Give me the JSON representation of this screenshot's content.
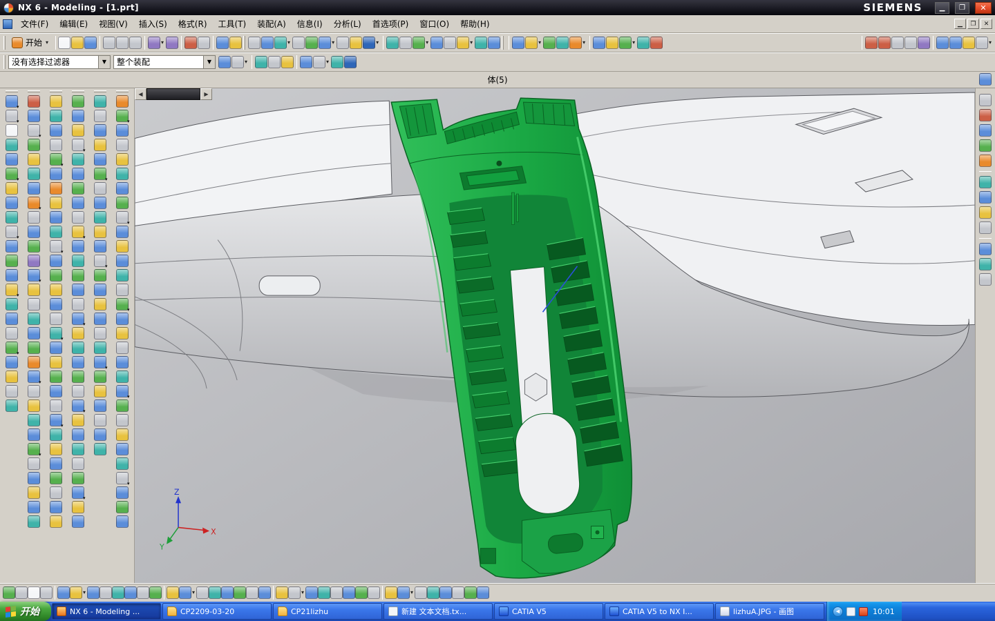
{
  "window": {
    "title": "NX 6 - Modeling - [1.prt]",
    "brand": "SIEMENS"
  },
  "menubar": {
    "items": [
      "文件(F)",
      "编辑(E)",
      "视图(V)",
      "插入(S)",
      "格式(R)",
      "工具(T)",
      "装配(A)",
      "信息(I)",
      "分析(L)",
      "首选项(P)",
      "窗口(O)",
      "帮助(H)"
    ]
  },
  "toolbars": {
    "start_button": "开始",
    "filter_value": "没有选择过滤器",
    "scope_value": "整个装配"
  },
  "infobar": {
    "message": "体(5)"
  },
  "viewport": {
    "triad": {
      "x": "X",
      "y": "Y",
      "z": "Z"
    }
  },
  "taskbar": {
    "start": "开始",
    "buttons": [
      {
        "label": "NX 6 - Modeling ...",
        "icon": "nx-app-icon"
      },
      {
        "label": "CP2209-03-20",
        "icon": "folder-icon"
      },
      {
        "label": "CP21lizhu",
        "icon": "folder-icon"
      },
      {
        "label": "新建 文本文档.tx...",
        "icon": "notepad-icon"
      },
      {
        "label": "CATIA V5",
        "icon": "catia-icon"
      },
      {
        "label": "CATIA V5 to NX I...",
        "icon": "catia-icon"
      },
      {
        "label": "lizhuA.JPG - 画图",
        "icon": "paint-icon"
      }
    ],
    "time": "10:01"
  },
  "colors": {
    "toolbar-gray": "#d4d0c8",
    "taskbar-blue": "#2a65dd",
    "start-green": "#3f9c38",
    "part-green": "#18a844",
    "close-red": "#e8502e"
  },
  "icons": {
    "palette": [
      "#5b8dd9",
      "#e8c23f",
      "#56b04e",
      "#3fb3a9",
      "#cc5f45",
      "#9078c2",
      "#c3c6cc",
      "#2e66b8",
      "#e98a2b",
      "#f5f6f8"
    ],
    "strips": {
      "tb1std": {
        "name": "standard-tool",
        "count": 12,
        "seq": [
          9,
          1,
          0,
          6,
          6,
          6,
          5,
          5,
          4,
          6,
          0,
          1
        ],
        "dropdowns": [
          6
        ],
        "separators": [
          3,
          6,
          8,
          10
        ]
      },
      "tb1view": {
        "name": "view-tool",
        "count": 17,
        "seq": [
          6,
          0,
          3,
          6,
          2,
          0,
          6,
          1,
          7,
          3,
          6,
          2,
          0,
          6,
          1,
          3,
          0
        ],
        "dropdowns": [
          2,
          5,
          8,
          11,
          14
        ],
        "separators": [
          9
        ]
      },
      "tb1form": {
        "name": "feature-tool",
        "count": 10,
        "seq": [
          0,
          1,
          2,
          3,
          8,
          0,
          1,
          2,
          3,
          4
        ],
        "dropdowns": [
          1,
          4,
          7
        ],
        "separators": [
          0,
          5
        ]
      },
      "tb1play": {
        "name": "playback-tool",
        "count": 9,
        "seq": [
          4,
          4,
          6,
          6,
          5,
          0,
          0,
          1,
          6
        ],
        "dropdowns": [
          8
        ],
        "separators": [
          0,
          5
        ]
      },
      "tb2sel": {
        "name": "snap-point",
        "count": 9,
        "seq": [
          0,
          6,
          3,
          6,
          1,
          0,
          6,
          3,
          7
        ],
        "dropdowns": [
          1,
          6
        ],
        "separators": [
          2,
          5
        ]
      },
      "col1": {
        "name": "direct-sketch",
        "count": 22,
        "corner": true,
        "seq": [
          0,
          6,
          9,
          3,
          0,
          2,
          1,
          0,
          3,
          6,
          0,
          2,
          0,
          1,
          3,
          0,
          6,
          2,
          0,
          1,
          6,
          3
        ],
        "dropdowns": [
          0,
          1,
          5,
          9,
          13,
          17
        ]
      },
      "col2": {
        "name": "feature-palette",
        "count": 30,
        "corner": true,
        "seq": [
          4,
          0,
          6,
          2,
          1,
          3,
          0,
          8,
          6,
          0,
          2,
          5,
          0,
          1,
          6,
          3,
          0,
          2,
          8,
          0,
          6,
          1,
          3,
          0,
          2,
          6,
          0,
          1,
          0,
          3
        ],
        "dropdowns": [
          2,
          7,
          12,
          19,
          24
        ]
      },
      "col3": {
        "name": "surface-palette",
        "count": 30,
        "corner": true,
        "seq": [
          1,
          3,
          0,
          6,
          2,
          0,
          8,
          1,
          0,
          3,
          6,
          0,
          2,
          1,
          0,
          6,
          3,
          0,
          1,
          2,
          0,
          6,
          0,
          3,
          1,
          0,
          2,
          6,
          0,
          1
        ],
        "dropdowns": [
          4,
          10,
          16,
          22
        ]
      },
      "col4": {
        "name": "edit-palette",
        "count": 30,
        "corner": true,
        "seq": [
          2,
          0,
          1,
          6,
          3,
          0,
          2,
          0,
          6,
          1,
          0,
          3,
          2,
          0,
          6,
          0,
          1,
          3,
          0,
          2,
          6,
          0,
          1,
          0,
          3,
          6,
          2,
          0,
          1,
          0
        ],
        "dropdowns": [
          3,
          9,
          15,
          21,
          27
        ]
      },
      "col5": {
        "name": "analysis-palette",
        "count": 25,
        "corner": true,
        "seq": [
          3,
          6,
          0,
          1,
          0,
          2,
          6,
          0,
          3,
          1,
          0,
          6,
          2,
          0,
          1,
          0,
          6,
          3,
          0,
          2,
          1,
          0,
          6,
          0,
          3
        ],
        "dropdowns": [
          5,
          11,
          18
        ]
      },
      "col6": {
        "name": "utility-palette",
        "count": 30,
        "corner": true,
        "seq": [
          8,
          2,
          0,
          6,
          1,
          3,
          0,
          2,
          6,
          0,
          1,
          0,
          3,
          6,
          2,
          0,
          1,
          6,
          0,
          3,
          0,
          2,
          6,
          1,
          0,
          3,
          6,
          0,
          2,
          0
        ],
        "dropdowns": [
          1,
          8,
          14,
          20,
          26
        ]
      },
      "rightbar": {
        "name": "resource-bar",
        "count": 12,
        "seq": [
          6,
          4,
          0,
          2,
          8,
          3,
          0,
          1,
          6,
          0,
          3,
          6
        ],
        "separators": [
          5,
          9
        ]
      },
      "bottombar": {
        "name": "status-tool",
        "count": 36,
        "seq": [
          2,
          6,
          9,
          6,
          0,
          1,
          0,
          6,
          3,
          0,
          6,
          2,
          1,
          0,
          6,
          3,
          0,
          2,
          6,
          0,
          1,
          6,
          0,
          3,
          6,
          0,
          2,
          6,
          1,
          0,
          6,
          3,
          0,
          6,
          2,
          0
        ],
        "dropdowns": [
          5,
          13,
          21,
          29
        ],
        "separators": [
          4,
          12,
          20,
          28
        ]
      }
    }
  }
}
